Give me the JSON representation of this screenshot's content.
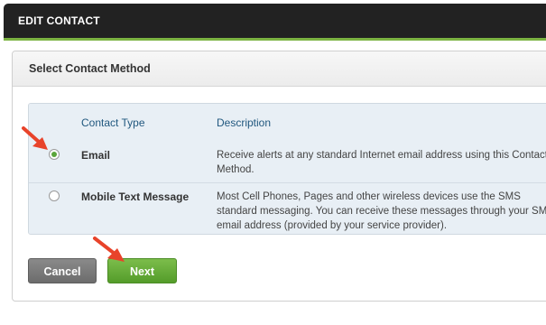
{
  "header": {
    "title": "EDIT CONTACT"
  },
  "panel": {
    "title": "Select Contact Method"
  },
  "table": {
    "columns": [
      "Contact Type",
      "Description"
    ],
    "rows": [
      {
        "type": "Email",
        "description": "Receive alerts at any standard Internet email address using this Contact Method.",
        "selected": true
      },
      {
        "type": "Mobile Text Message",
        "description": "Most Cell Phones, Pages and other wireless devices use the SMS standard messaging. You can receive these messages through your SMS email address (provided by your service provider).",
        "selected": false
      }
    ]
  },
  "buttons": {
    "cancel": "Cancel",
    "next": "Next"
  },
  "colors": {
    "accent": "#7cb342",
    "header_bg": "#222222",
    "annotation_arrow": "#e8432a"
  }
}
